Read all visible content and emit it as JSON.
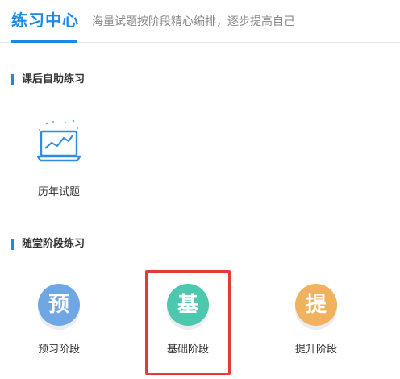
{
  "header": {
    "title": "练习中心",
    "subtitle": "海量试题按阶段精心编排，逐步提高自己"
  },
  "sections": [
    {
      "title": "课后自助练习",
      "items": [
        {
          "label": "历年试题",
          "icon": "laptop-chart-icon"
        }
      ]
    },
    {
      "title": "随堂阶段练习",
      "items": [
        {
          "label": "预习阶段",
          "icon_char": "预",
          "color": "#6fa6e4"
        },
        {
          "label": "基础阶段",
          "icon_char": "基",
          "color": "#4dc7ae",
          "highlighted": true
        },
        {
          "label": "提升阶段",
          "icon_char": "提",
          "color": "#f0b25e"
        }
      ]
    }
  ],
  "colors": {
    "accent": "#1e88e5",
    "highlight": "#e53935"
  }
}
